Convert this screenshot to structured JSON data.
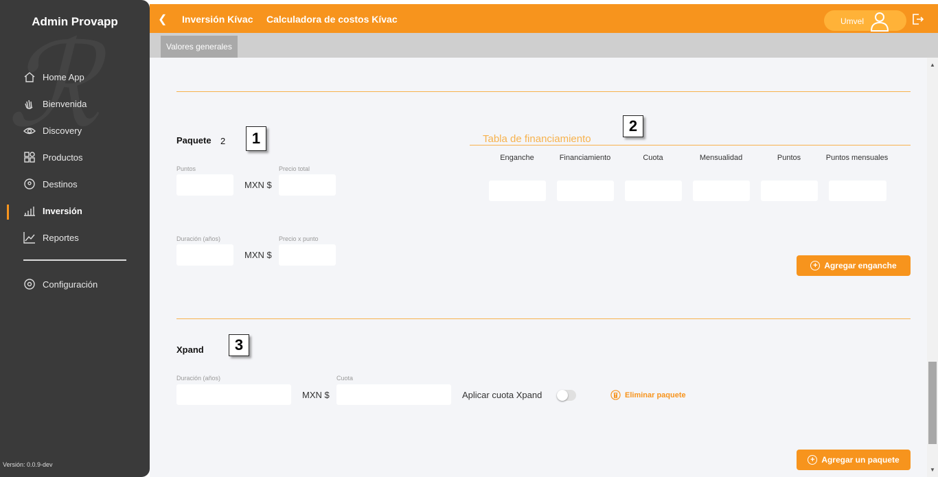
{
  "sidebar": {
    "brand": "Admin Provapp",
    "items": [
      {
        "label": "Home App",
        "icon": "home-icon"
      },
      {
        "label": "Bienvenida",
        "icon": "wave-hand-icon"
      },
      {
        "label": "Discovery",
        "icon": "eye-icon"
      },
      {
        "label": "Productos",
        "icon": "grid-icon"
      },
      {
        "label": "Destinos",
        "icon": "location-pin-icon"
      },
      {
        "label": "Inversión",
        "icon": "bar-chart-icon",
        "active": true
      },
      {
        "label": "Reportes",
        "icon": "trend-line-icon"
      }
    ],
    "settings_label": "Configuración",
    "version": "Versión: 0.0.9-dev"
  },
  "header": {
    "crumb1": "Inversión Kívac",
    "crumb2": "Calculadora de costos Kívac",
    "user_name": "Umvel",
    "accent_color": "#f7941d"
  },
  "tabs": [
    "Valores generales"
  ],
  "paquete": {
    "title": "Paquete",
    "number": "2",
    "puntos_label": "Puntos",
    "precio_total_label": "Precio total",
    "duracion_label": "Duración (años)",
    "precio_punto_label": "Precio x punto",
    "currency": "MXN $"
  },
  "financiamiento": {
    "title": "Tabla de financiamiento",
    "columns": [
      "Enganche",
      "Financiamiento",
      "Cuota",
      "Mensualidad",
      "Puntos",
      "Puntos mensuales"
    ],
    "add_button": "Agregar enganche"
  },
  "xpand": {
    "title": "Xpand",
    "duracion_label": "Duración (años)",
    "cuota_label": "Cuota",
    "currency": "MXN $",
    "toggle_label": "Aplicar cuota Xpand",
    "delete_label": "Eliminar paquete"
  },
  "add_package_button": "Agregar un paquete",
  "annotations": [
    "1",
    "2",
    "3"
  ]
}
